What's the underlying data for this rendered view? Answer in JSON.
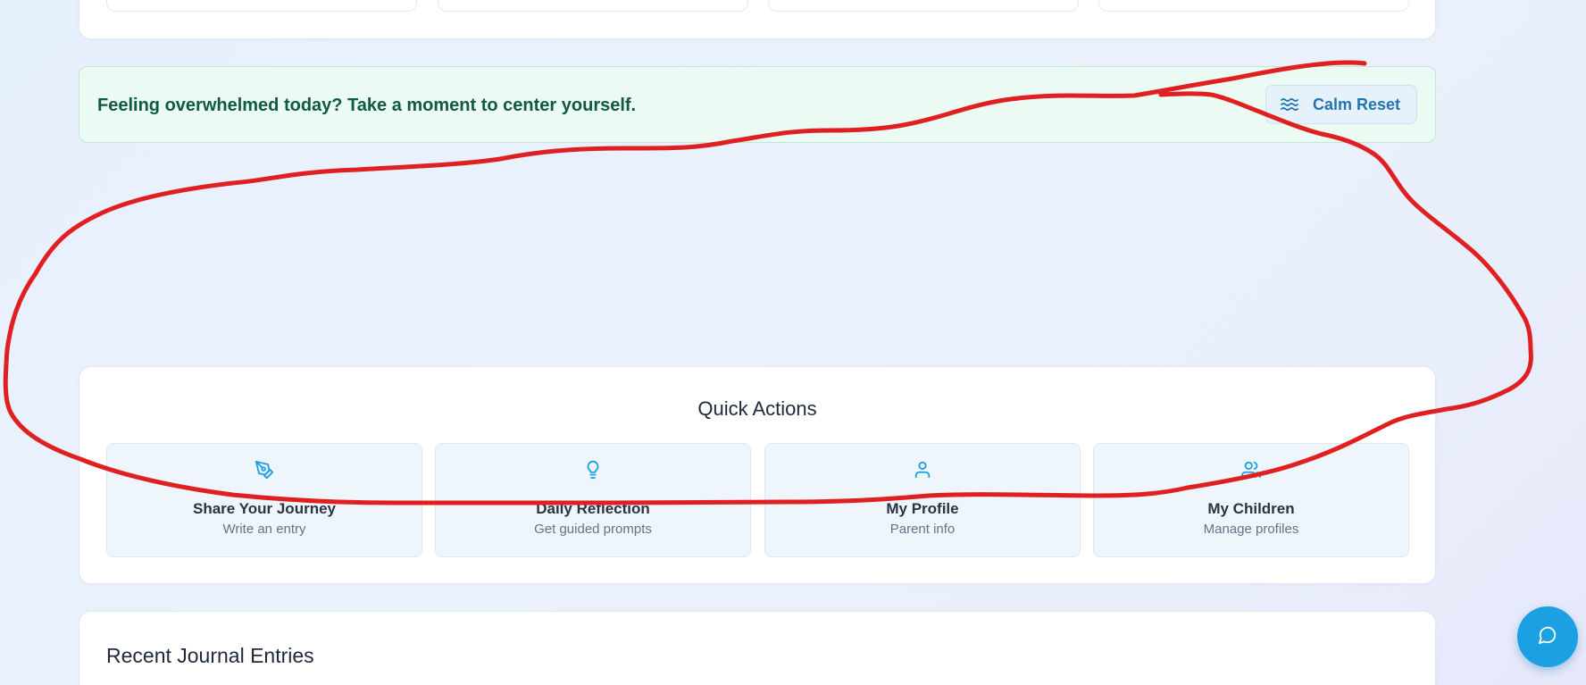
{
  "calm_banner": {
    "message": "Feeling overwhelmed today? Take a moment to center yourself.",
    "button_label": "Calm Reset",
    "button_icon": "waves-icon"
  },
  "quick_actions": {
    "title": "Quick Actions",
    "items": [
      {
        "label": "Share Your Journey",
        "sub": "Write an entry",
        "icon": "pen-tool-icon"
      },
      {
        "label": "Daily Reflection",
        "sub": "Get guided prompts",
        "icon": "lightbulb-icon"
      },
      {
        "label": "My Profile",
        "sub": "Parent info",
        "icon": "user-icon"
      },
      {
        "label": "My Children",
        "sub": "Manage profiles",
        "icon": "users-icon"
      }
    ]
  },
  "recent_entries": {
    "title": "Recent Journal Entries"
  },
  "chat": {
    "icon": "message-circle-icon"
  },
  "colors": {
    "accent": "#1ba0e2",
    "banner_bg": "#ebfaf3",
    "banner_text": "#0f5a43",
    "annotation": "#e02020"
  }
}
